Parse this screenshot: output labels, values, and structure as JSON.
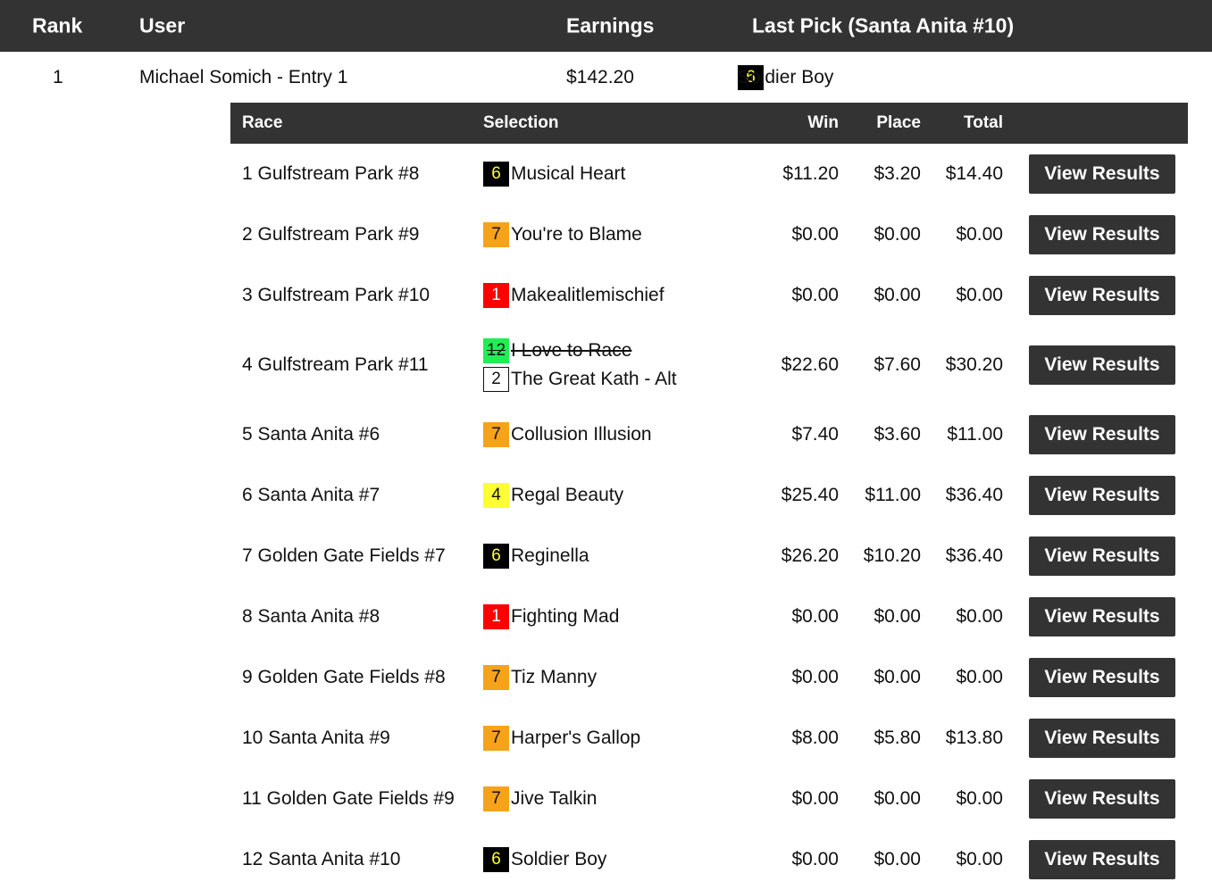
{
  "header": {
    "rank": "Rank",
    "user": "User",
    "earnings": "Earnings",
    "last_pick": "Last Pick (Santa Anita #10)"
  },
  "entry": {
    "rank": "1",
    "user": "Michael Somich - Entry 1",
    "earnings": "$142.20",
    "last_pick": {
      "number": "6",
      "color": "black",
      "name": "Soldier Boy"
    }
  },
  "detail_header": {
    "race": "Race",
    "selection": "Selection",
    "win": "Win",
    "place": "Place",
    "total": "Total"
  },
  "colors": {
    "header_bg": "#333333",
    "black": "#000000",
    "orange": "#f7a21b",
    "red": "#ff0000",
    "yellow": "#ffff33",
    "green": "#21ee55",
    "white": "#ffffff"
  },
  "races": [
    {
      "race": "1 Gulfstream Park #8",
      "selections": [
        {
          "number": "6",
          "color": "black",
          "name": "Musical Heart"
        }
      ],
      "win": "$11.20",
      "place": "$3.20",
      "total": "$14.40",
      "button": "View Results"
    },
    {
      "race": "2 Gulfstream Park #9",
      "selections": [
        {
          "number": "7",
          "color": "orange",
          "name": "You're to Blame"
        }
      ],
      "win": "$0.00",
      "place": "$0.00",
      "total": "$0.00",
      "button": "View Results"
    },
    {
      "race": "3 Gulfstream Park #10",
      "selections": [
        {
          "number": "1",
          "color": "red",
          "name": "Makealitlemischief"
        }
      ],
      "win": "$0.00",
      "place": "$0.00",
      "total": "$0.00",
      "button": "View Results"
    },
    {
      "race": "4 Gulfstream Park #11",
      "selections": [
        {
          "number": "12",
          "color": "green",
          "name": "I Love to Race",
          "scratched": true
        },
        {
          "number": "2",
          "color": "white",
          "name": "The Great Kath - Alt"
        }
      ],
      "win": "$22.60",
      "place": "$7.60",
      "total": "$30.20",
      "button": "View Results"
    },
    {
      "race": "5 Santa Anita #6",
      "selections": [
        {
          "number": "7",
          "color": "orange",
          "name": "Collusion Illusion"
        }
      ],
      "win": "$7.40",
      "place": "$3.60",
      "total": "$11.00",
      "button": "View Results"
    },
    {
      "race": "6 Santa Anita #7",
      "selections": [
        {
          "number": "4",
          "color": "yellow",
          "name": "Regal Beauty"
        }
      ],
      "win": "$25.40",
      "place": "$11.00",
      "total": "$36.40",
      "button": "View Results"
    },
    {
      "race": "7 Golden Gate Fields #7",
      "selections": [
        {
          "number": "6",
          "color": "black",
          "name": "Reginella"
        }
      ],
      "win": "$26.20",
      "place": "$10.20",
      "total": "$36.40",
      "button": "View Results"
    },
    {
      "race": "8 Santa Anita #8",
      "selections": [
        {
          "number": "1",
          "color": "red",
          "name": "Fighting Mad"
        }
      ],
      "win": "$0.00",
      "place": "$0.00",
      "total": "$0.00",
      "button": "View Results"
    },
    {
      "race": "9 Golden Gate Fields #8",
      "selections": [
        {
          "number": "7",
          "color": "orange",
          "name": "Tiz Manny"
        }
      ],
      "win": "$0.00",
      "place": "$0.00",
      "total": "$0.00",
      "button": "View Results"
    },
    {
      "race": "10 Santa Anita #9",
      "selections": [
        {
          "number": "7",
          "color": "orange",
          "name": "Harper's Gallop"
        }
      ],
      "win": "$8.00",
      "place": "$5.80",
      "total": "$13.80",
      "button": "View Results"
    },
    {
      "race": "11 Golden Gate Fields #9",
      "selections": [
        {
          "number": "7",
          "color": "orange",
          "name": "Jive Talkin"
        }
      ],
      "win": "$0.00",
      "place": "$0.00",
      "total": "$0.00",
      "button": "View Results"
    },
    {
      "race": "12 Santa Anita #10",
      "selections": [
        {
          "number": "6",
          "color": "black",
          "name": "Soldier Boy"
        }
      ],
      "win": "$0.00",
      "place": "$0.00",
      "total": "$0.00",
      "button": "View Results"
    }
  ]
}
